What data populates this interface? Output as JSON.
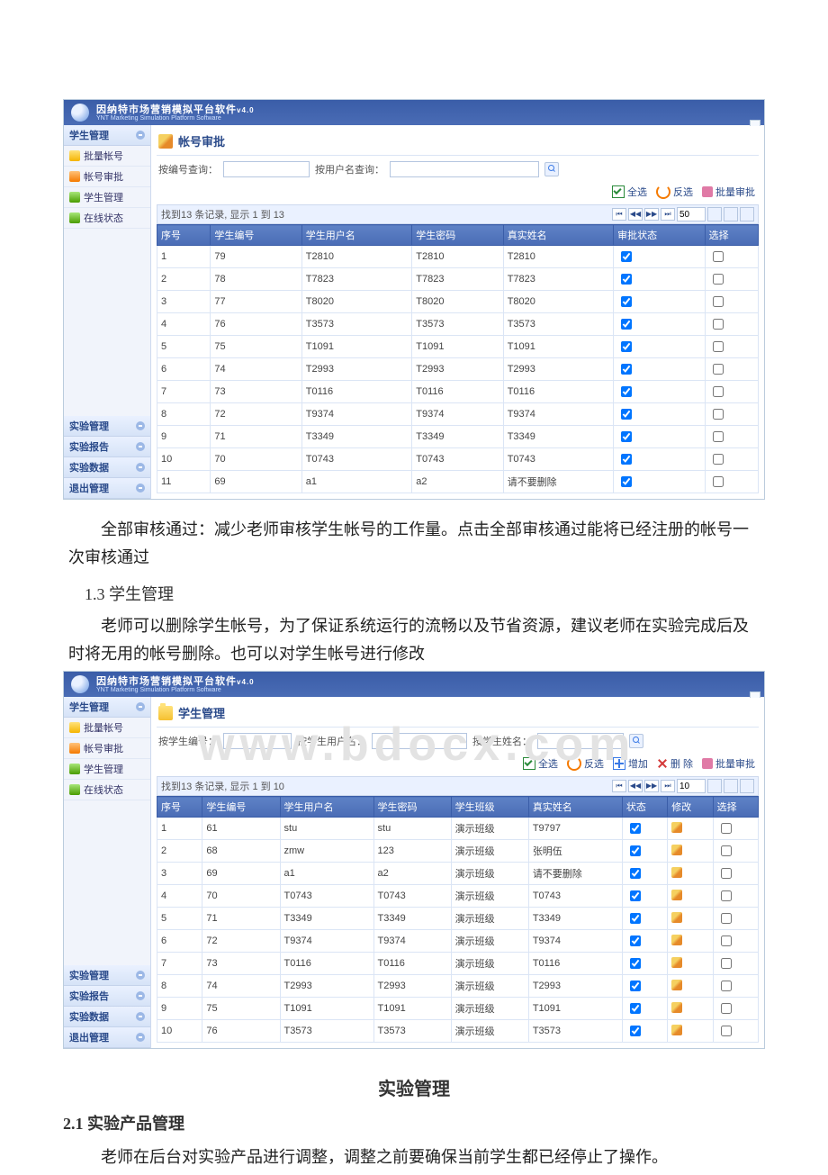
{
  "software": {
    "title_cn": "因纳特市场营销模拟平台软件",
    "version_suffix": "v4.0",
    "title_en": "YNT Marketing Simulation Platform Software"
  },
  "sidebar_top": {
    "group": "学生管理",
    "items": [
      {
        "label": "批量帐号",
        "icon": "ic-yellow"
      },
      {
        "label": "帐号审批",
        "icon": "ic-orange"
      },
      {
        "label": "学生管理",
        "icon": "ic-green"
      },
      {
        "label": "在线状态",
        "icon": "ic-green"
      }
    ]
  },
  "sidebar_bottom": [
    "实验管理",
    "实验报告",
    "实验数据",
    "退出管理"
  ],
  "screen1": {
    "heading": "帐号审批",
    "search": {
      "label1": "按编号查询：",
      "label2": "按用户名查询："
    },
    "toolbar": {
      "select_all": "全选",
      "invert": "反选",
      "batch": "批量审批"
    },
    "summary": "找到13 条记录, 显示 1 到 13",
    "page_size": "50",
    "columns": [
      "序号",
      "学生编号",
      "学生用户名",
      "学生密码",
      "真实姓名",
      "审批状态",
      "选择"
    ],
    "rows": [
      {
        "idx": "1",
        "no": "79",
        "user": "T2810",
        "pwd": "T2810",
        "name": "T2810",
        "approved": true
      },
      {
        "idx": "2",
        "no": "78",
        "user": "T7823",
        "pwd": "T7823",
        "name": "T7823",
        "approved": true
      },
      {
        "idx": "3",
        "no": "77",
        "user": "T8020",
        "pwd": "T8020",
        "name": "T8020",
        "approved": true
      },
      {
        "idx": "4",
        "no": "76",
        "user": "T3573",
        "pwd": "T3573",
        "name": "T3573",
        "approved": true
      },
      {
        "idx": "5",
        "no": "75",
        "user": "T1091",
        "pwd": "T1091",
        "name": "T1091",
        "approved": true
      },
      {
        "idx": "6",
        "no": "74",
        "user": "T2993",
        "pwd": "T2993",
        "name": "T2993",
        "approved": true
      },
      {
        "idx": "7",
        "no": "73",
        "user": "T0116",
        "pwd": "T0116",
        "name": "T0116",
        "approved": true
      },
      {
        "idx": "8",
        "no": "72",
        "user": "T9374",
        "pwd": "T9374",
        "name": "T9374",
        "approved": true
      },
      {
        "idx": "9",
        "no": "71",
        "user": "T3349",
        "pwd": "T3349",
        "name": "T3349",
        "approved": true
      },
      {
        "idx": "10",
        "no": "70",
        "user": "T0743",
        "pwd": "T0743",
        "name": "T0743",
        "approved": true
      },
      {
        "idx": "11",
        "no": "69",
        "user": "a1",
        "pwd": "a2",
        "name": "请不要删除",
        "approved": true
      }
    ]
  },
  "para1": "　　全部审核通过：减少老师审核学生帐号的工作量。点击全部审核通过能将已经注册的帐号一次审核通过",
  "sub_1_3": "1.3 学生管理",
  "para2": "　　老师可以删除学生帐号，为了保证系统运行的流畅以及节省资源，建议老师在实验完成后及时将无用的帐号删除。也可以对学生帐号进行修改",
  "watermark": "www.bdocx.com",
  "screen2": {
    "heading": "学生管理",
    "search": {
      "label1": "按学生编号：",
      "label2": "按学生用户名：",
      "label3": "按学生姓名："
    },
    "toolbar": {
      "select_all": "全选",
      "invert": "反选",
      "add": "增加",
      "del": "删 除",
      "batch": "批量审批"
    },
    "summary": "找到13 条记录, 显示 1 到 10",
    "page_size": "10",
    "columns": [
      "序号",
      "学生编号",
      "学生用户名",
      "学生密码",
      "学生班级",
      "真实姓名",
      "状态",
      "修改",
      "选择"
    ],
    "rows": [
      {
        "idx": "1",
        "no": "61",
        "user": "stu",
        "pwd": "stu",
        "cls": "演示班级",
        "name": "T9797"
      },
      {
        "idx": "2",
        "no": "68",
        "user": "zmw",
        "pwd": "123",
        "cls": "演示班级",
        "name": "张明伍"
      },
      {
        "idx": "3",
        "no": "69",
        "user": "a1",
        "pwd": "a2",
        "cls": "演示班级",
        "name": "请不要删除"
      },
      {
        "idx": "4",
        "no": "70",
        "user": "T0743",
        "pwd": "T0743",
        "cls": "演示班级",
        "name": "T0743"
      },
      {
        "idx": "5",
        "no": "71",
        "user": "T3349",
        "pwd": "T3349",
        "cls": "演示班级",
        "name": "T3349"
      },
      {
        "idx": "6",
        "no": "72",
        "user": "T9374",
        "pwd": "T9374",
        "cls": "演示班级",
        "name": "T9374"
      },
      {
        "idx": "7",
        "no": "73",
        "user": "T0116",
        "pwd": "T0116",
        "cls": "演示班级",
        "name": "T0116"
      },
      {
        "idx": "8",
        "no": "74",
        "user": "T2993",
        "pwd": "T2993",
        "cls": "演示班级",
        "name": "T2993"
      },
      {
        "idx": "9",
        "no": "75",
        "user": "T1091",
        "pwd": "T1091",
        "cls": "演示班级",
        "name": "T1091"
      },
      {
        "idx": "10",
        "no": "76",
        "user": "T3573",
        "pwd": "T3573",
        "cls": "演示班级",
        "name": "T3573"
      }
    ]
  },
  "h2": "实验管理",
  "h3": "2.1 实验产品管理",
  "para3": "　　老师在后台对实验产品进行调整，调整之前要确保当前学生都已经停止了操作。"
}
